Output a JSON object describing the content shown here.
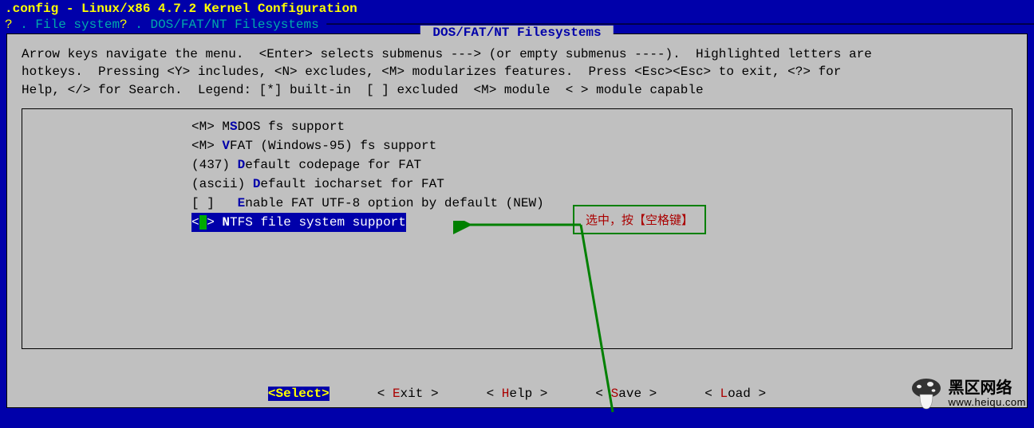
{
  "title": ".config - Linux/x86 4.7.2 Kernel Configuration",
  "breadcrumb": {
    "prefix1": "?",
    "sep": " . ",
    "item1": "File system",
    "prefix2": "?",
    "item2": "DOS/FAT/NT Filesystems",
    "dashline": " ─────────────────────────────────────────────────────────────────────────────────────────────────────"
  },
  "panel_title": " DOS/FAT/NT Filesystems ",
  "help_text": "Arrow keys navigate the menu.  <Enter> selects submenus ---> (or empty submenus ----).  Highlighted letters are\nhotkeys.  Pressing <Y> includes, <N> excludes, <M> modularizes features.  Press <Esc><Esc> to exit, <?> for\nHelp, </> for Search.  Legend: [*] built-in  [ ] excluded  <M> module  < > module capable",
  "menu": [
    {
      "prefix": "<M>",
      "pre_hot": "M",
      "hot": "S",
      "rest": "DOS fs support",
      "selected": false
    },
    {
      "prefix": "<M>",
      "pre_hot": "",
      "hot": "V",
      "rest": "FAT (Windows-95) fs support",
      "selected": false
    },
    {
      "prefix": "(437)",
      "pre_hot": "",
      "hot": "D",
      "rest": "efault codepage for FAT",
      "selected": false
    },
    {
      "prefix": "(ascii)",
      "pre_hot": "",
      "hot": "D",
      "rest": "efault iocharset for FAT",
      "selected": false
    },
    {
      "prefix": "[ ]  ",
      "pre_hot": "",
      "hot": "E",
      "rest": "nable FAT UTF-8 option by default (NEW)",
      "selected": false
    },
    {
      "prefix": "< >",
      "pre_hot": "",
      "hot": "N",
      "rest": "TFS file system support",
      "selected": true
    }
  ],
  "annotation": "选中，按【空格键】",
  "buttons": [
    {
      "label": "Select",
      "hot": "S",
      "rest": "elect",
      "selected": true
    },
    {
      "label": "Exit",
      "hot": "E",
      "rest": "xit",
      "selected": false
    },
    {
      "label": "Help",
      "hot": "H",
      "rest": "elp",
      "selected": false
    },
    {
      "label": "Save",
      "hot": "S",
      "rest": "ave",
      "selected": false
    },
    {
      "label": "Load",
      "hot": "L",
      "rest": "oad",
      "selected": false
    }
  ],
  "watermark": {
    "cn": "黑区网络",
    "url": "www.heiqu.com"
  }
}
